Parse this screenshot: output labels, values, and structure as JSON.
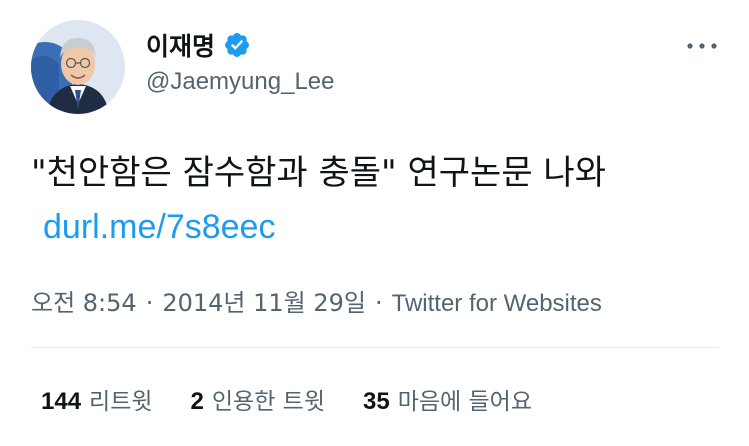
{
  "author": {
    "display_name": "이재명",
    "handle": "@Jaemyung_Lee",
    "verified": true
  },
  "tweet": {
    "text": "\"천안함은 잠수함과 충돌\" 연구논문 나와",
    "link": "durl.me/7s8eec"
  },
  "meta": {
    "time": "오전 8:54",
    "date": "2014년 11월 29일",
    "source": "Twitter for Websites",
    "separator": "·"
  },
  "stats": {
    "retweets_count": "144",
    "retweets_label": "리트윗",
    "quotes_count": "2",
    "quotes_label": "인용한 트윗",
    "likes_count": "35",
    "likes_label": "마음에 들어요"
  },
  "colors": {
    "link": "#1d9bf0",
    "secondary_text": "#536471",
    "verified_badge": "#1d9bf0"
  },
  "icons": {
    "verified": "verified-badge-icon",
    "more": "more-horizontal-icon"
  }
}
